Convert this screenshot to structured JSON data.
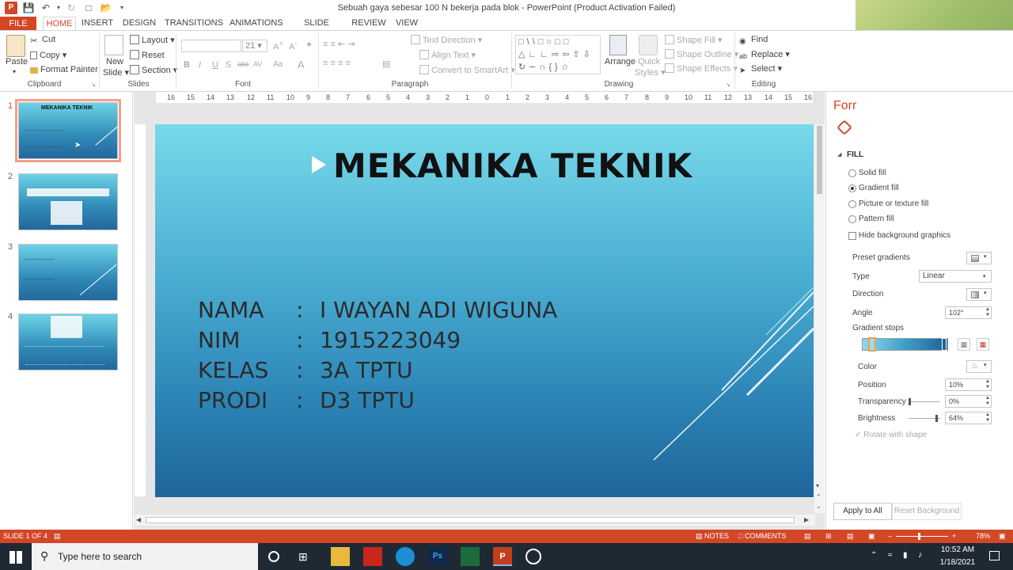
{
  "window": {
    "title": "Sebuah gaya sebesar 100 N bekerja pada blok - PowerPoint (Product Activation Failed)"
  },
  "tabs": [
    "FILE",
    "HOME",
    "INSERT",
    "DESIGN",
    "TRANSITIONS",
    "ANIMATIONS",
    "SLIDE SHOW",
    "REVIEW",
    "VIEW"
  ],
  "ribbon": {
    "clipboard": {
      "paste": "Paste",
      "cut": "Cut",
      "copy": "Copy",
      "format_painter": "Format Painter",
      "label": "Clipboard"
    },
    "slides": {
      "new_slide_1": "New",
      "new_slide_2": "Slide",
      "layout": "Layout",
      "reset": "Reset",
      "section": "Section",
      "label": "Slides"
    },
    "font": {
      "size": "21",
      "bold": "B",
      "italic": "I",
      "underline": "U",
      "shadow": "S",
      "strike": "abc",
      "spacing": "AV",
      "case": "Aa",
      "label": "Font"
    },
    "paragraph": {
      "text_direction": "Text Direction",
      "align_text": "Align Text",
      "convert": "Convert to SmartArt",
      "label": "Paragraph"
    },
    "drawing": {
      "arrange": "Arrange",
      "quick_styles_1": "Quick",
      "quick_styles_2": "Styles",
      "shape_fill": "Shape Fill",
      "shape_outline": "Shape Outline",
      "shape_effects": "Shape Effects",
      "label": "Drawing"
    },
    "editing": {
      "find": "Find",
      "replace": "Replace",
      "select": "Select",
      "label": "Editing"
    }
  },
  "thumbnails": [
    {
      "num": "1",
      "title": "MEKANIKA TEKNIK"
    },
    {
      "num": "2"
    },
    {
      "num": "3"
    },
    {
      "num": "4"
    }
  ],
  "ruler": {
    "h": [
      "16",
      "15",
      "14",
      "13",
      "12",
      "11",
      "10",
      "9",
      "8",
      "7",
      "6",
      "5",
      "4",
      "3",
      "2",
      "1",
      "0",
      "1",
      "2",
      "3",
      "4",
      "5",
      "6",
      "7",
      "8",
      "9",
      "10",
      "11",
      "12",
      "13",
      "14",
      "15",
      "16"
    ]
  },
  "slide": {
    "title": "MEKANIKA TEKNIK",
    "rows": [
      {
        "label": "NAMA",
        "colon": ":",
        "value": "I WAYAN ADI WIGUNA"
      },
      {
        "label": "NIM",
        "colon": ":",
        "value": "1915223049"
      },
      {
        "label": "KELAS",
        "colon": ":",
        "value": "3A TPTU"
      },
      {
        "label": "PRODI",
        "colon": ":",
        "value": "D3 TPTU"
      }
    ]
  },
  "format_pane": {
    "title": "Forr",
    "section": "FILL",
    "options": [
      "Solid fill",
      "Gradient fill",
      "Picture or texture fill",
      "Pattern fill"
    ],
    "selected_option": "Gradient fill",
    "hide_bg": "Hide background graphics",
    "preset_gradients": "Preset gradients",
    "type_label": "Type",
    "type_value": "Linear",
    "direction": "Direction",
    "angle_label": "Angle",
    "angle_value": "102°",
    "gradient_stops": "Gradient stops",
    "color": "Color",
    "position_label": "Position",
    "position_value": "10%",
    "transparency_label": "Transparency",
    "transparency_value": "0%",
    "brightness_label": "Brightness",
    "brightness_value": "64%",
    "rotate": "Rotate with shape",
    "apply_all": "Apply to All",
    "reset_bg": "Reset Background"
  },
  "status": {
    "slide": "SLIDE 1 OF 4",
    "notes": "NOTES",
    "comments": "COMMENTS",
    "zoom": "78%"
  },
  "taskbar": {
    "search_placeholder": "Type here to search",
    "time": "10:52 AM",
    "date": "1/18/2021"
  },
  "colors": {
    "accent": "#d24726",
    "slide_top": "#78d9ea",
    "slide_bottom": "#1f659b"
  }
}
